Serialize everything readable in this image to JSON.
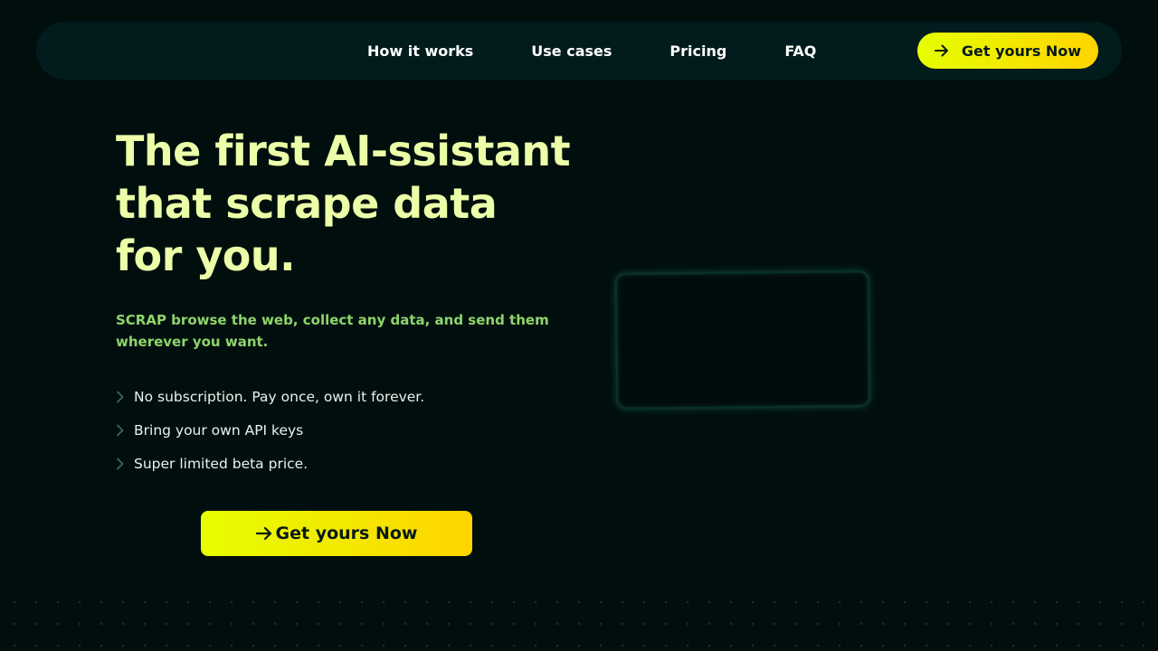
{
  "nav": {
    "links": [
      {
        "label": "How it works"
      },
      {
        "label": "Use cases"
      },
      {
        "label": "Pricing"
      },
      {
        "label": "FAQ"
      }
    ],
    "cta_label": "Get yours Now",
    "cta_icon": "arrow-right-icon"
  },
  "hero": {
    "title_lines": [
      "The first AI-ssistant",
      "that scrape data",
      "for you."
    ],
    "subtitle_lines": [
      "SCRAP browse the web, collect any data, and send them",
      "wherever you want."
    ],
    "features": [
      {
        "text": "No subscription. Pay once, own it forever.",
        "icon": "chevron-right-icon"
      },
      {
        "text": "Bring your own API keys",
        "icon": "chevron-right-icon"
      },
      {
        "text": "Super limited beta price.",
        "icon": "chevron-right-icon"
      }
    ],
    "cta_label": "Get yours Now",
    "cta_icon": "arrow-right-icon"
  },
  "colors": {
    "background": "#000f0e",
    "navbar": "#021c1e",
    "title": "#ecffa8",
    "subtitle": "#8fd46a",
    "cta_gradient_start": "#e6ff00",
    "cta_gradient_end": "#ffd400"
  }
}
